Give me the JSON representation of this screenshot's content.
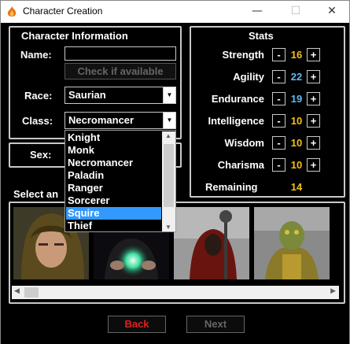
{
  "window": {
    "title": "Character Creation",
    "icon": "flame-app-icon"
  },
  "char_info": {
    "heading": "Character Information",
    "name_label": "Name:",
    "name_value": "",
    "check_button": "Check if available",
    "race_label": "Race:",
    "race_value": "Saurian",
    "class_label": "Class:",
    "class_value": "Necromancer",
    "class_options": [
      "Knight",
      "Monk",
      "Necromancer",
      "Paladin",
      "Ranger",
      "Sorcerer",
      "Squire",
      "Thief"
    ],
    "class_highlighted": "Squire"
  },
  "sex": {
    "label": "Sex:"
  },
  "portraits": {
    "label": "Select an"
  },
  "stats": {
    "heading": "Stats",
    "items": [
      {
        "name": "Strength",
        "value": "16",
        "color": "#f0c020"
      },
      {
        "name": "Agility",
        "value": "22",
        "color": "#66b8f0"
      },
      {
        "name": "Endurance",
        "value": "19",
        "color": "#66b8f0"
      },
      {
        "name": "Intelligence",
        "value": "10",
        "color": "#f0c020"
      },
      {
        "name": "Wisdom",
        "value": "10",
        "color": "#f0c020"
      },
      {
        "name": "Charisma",
        "value": "10",
        "color": "#f0c020"
      }
    ],
    "remaining_label": "Remaining",
    "remaining_value": "14",
    "minus": "-",
    "plus": "+"
  },
  "buttons": {
    "back": "Back",
    "next": "Next"
  },
  "colors": {
    "highlight": "#3399ff",
    "back_text": "#e02020",
    "next_text": "#666666"
  }
}
